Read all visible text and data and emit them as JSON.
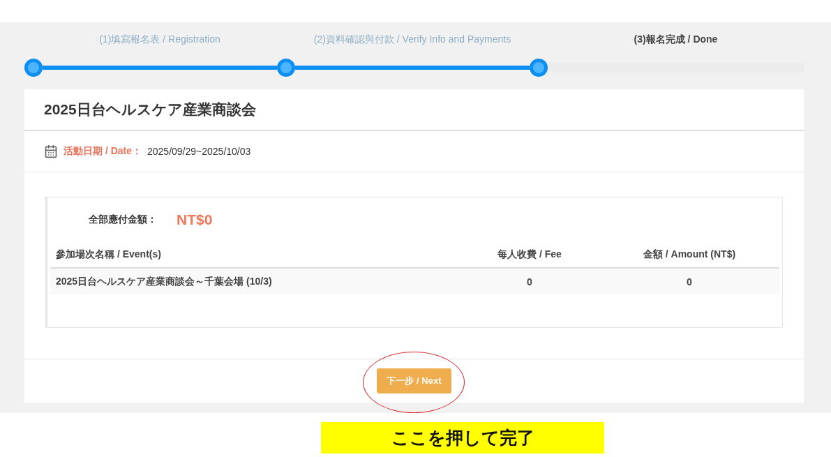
{
  "steps": [
    {
      "label": "(1)填寫報名表 / Registration",
      "selected": false
    },
    {
      "label": "(2)資料確認與付款 / Verify Info and Payments",
      "selected": false
    },
    {
      "label": "(3)報名完成 / Done",
      "selected": true
    }
  ],
  "event": {
    "title": "2025日台ヘルスケア産業商談会",
    "date_label": "活動日期 / Date：",
    "date_value": "2025/09/29~2025/10/03"
  },
  "payment": {
    "total_label": "全部應付金額：",
    "total_value": "NT$0",
    "table": {
      "columns": [
        "參加場次名稱 / Event(s)",
        "每人收費 / Fee",
        "金額 / Amount (NT$)"
      ],
      "rows": [
        [
          "2025日台ヘルスケア産業商談会～千葉会場 (10/3)",
          "0",
          "0"
        ]
      ]
    }
  },
  "next_button": "下一步 / Next",
  "annotation": "ここを押して完了"
}
